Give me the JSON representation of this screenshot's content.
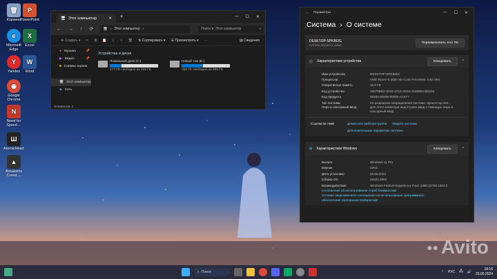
{
  "desktop": {
    "icons": [
      {
        "label": "Корзина",
        "color": "#8aa4c8"
      },
      {
        "label": "PowerPoint",
        "color": "#d35230"
      },
      {
        "label": "Microsoft Edge",
        "color": "#1a8ee0"
      },
      {
        "label": "Excel",
        "color": "#1d6f42"
      },
      {
        "label": "Yandex",
        "color": "#e12b2b"
      },
      {
        "label": "Word",
        "color": "#2b5797"
      },
      {
        "label": "Google Chrome",
        "color": "#dd4b39"
      },
      {
        "label": "Need for Speed ...",
        "color": "#c0392b"
      },
      {
        "label": "AtomicHeart",
        "color": "#222222"
      },
      {
        "label": "Assassins Creed ...",
        "color": "#333333"
      }
    ]
  },
  "explorer": {
    "tab_title": "Этот компьютер",
    "address": "Этот компьютер",
    "search_placeholder": "Поиск в: Этот компьютер",
    "toolbar": {
      "create": "Создать",
      "sort": "Сортировать",
      "view": "Просмотреть",
      "details": "Сведения"
    },
    "sidebar": [
      "Музыка",
      "Видео",
      "Снимки экрана",
      "Этот компьютер",
      "Сеть"
    ],
    "section_title": "Устройства и диски",
    "drives": [
      {
        "name": "Локальный диск (C:)",
        "free": "177 ГБ свободно из 232 ГБ",
        "used_fraction": 0.24
      },
      {
        "name": "Новый том (E:)",
        "free": "259 ГБ свободно из 465 ГБ",
        "used_fraction": 0.44
      }
    ],
    "status": "Элементов: 2"
  },
  "settings": {
    "title": "Параметры",
    "breadcrumb_parent": "Система",
    "breadcrumb_current": "О системе",
    "device_name": "DESKTOP-SPKBI2G",
    "device_sub": "SYSTEM_PRODUCT_NAME",
    "rename_btn": "Переименовать этот ПК",
    "device_section": "Характеристики устройства",
    "copy_btn": "Копировать",
    "device_specs": [
      {
        "k": "Имя устройства",
        "v": "DESKTOP-SPKBI2G"
      },
      {
        "k": "Процессор",
        "v": "AMD Ryzen 5 2600 Six-Core Processor    3.40 GHz"
      },
      {
        "k": "Оперативная память",
        "v": "16,0 ГБ"
      },
      {
        "k": "Код устройства",
        "v": "19579BD2-3A02-4714-AEDA-618884A581D4"
      },
      {
        "k": "Код продукта",
        "v": "00330-80000-00000-AA477"
      },
      {
        "k": "Тип системы",
        "v": "64-разрядная операционная система, процессор x64"
      },
      {
        "k": "Перо и сенсорный ввод",
        "v": "Для этого монитора недоступен ввод с помощью пера и сенсорный ввод"
      }
    ],
    "related_label": "Ссылки по теме",
    "related_links": [
      "Домен или рабочая группа",
      "Защита системы",
      "Дополнительные параметры системы"
    ],
    "windows_section": "Характеристики Windows",
    "windows_specs": [
      {
        "k": "Выпуск",
        "v": "Windows 11 Pro"
      },
      {
        "k": "Версия",
        "v": "22H2"
      },
      {
        "k": "Дата установки",
        "v": "22.05.2024"
      },
      {
        "k": "Сборка ОС",
        "v": "22621.3593"
      },
      {
        "k": "Взаимодействие",
        "v": "Windows Feature Experience Pack 1000.22700.1003.0"
      }
    ],
    "links": [
      "Соглашение об использовании служб Майкрософт",
      "Условия лицензионного соглашения на использование программного",
      "обеспечения корпорации Майкрософт"
    ]
  },
  "taskbar": {
    "search_label": "Поиск",
    "lang": "РУС",
    "time": "18:16",
    "date": "25.05.2024",
    "watermark": "Avito"
  }
}
